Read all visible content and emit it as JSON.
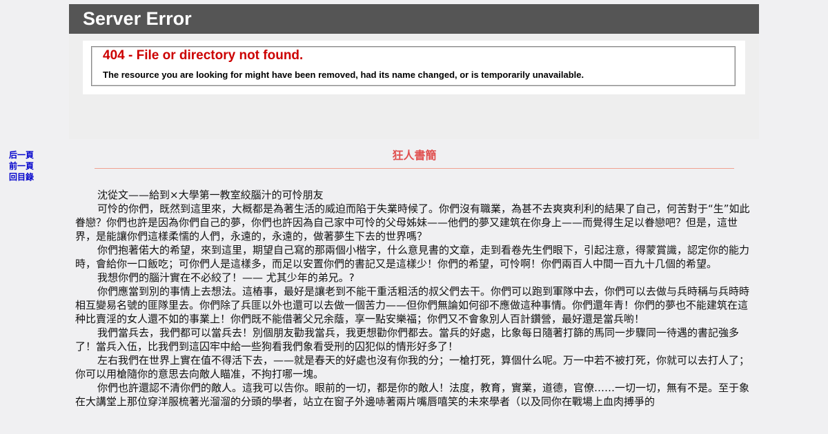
{
  "error": {
    "header": "Server Error",
    "code_line": "404 - File or directory not found.",
    "description": "The resource you are looking for might have been removed, had its name changed, or is temporarily unavailable."
  },
  "nav": {
    "prev": "后一頁",
    "next": "前一頁",
    "toc": "回目錄"
  },
  "book": {
    "title": "狂人書簡"
  },
  "article": {
    "paragraphs": [
      "沈從文——給到×大學第一教室絞腦汁的可怜朋友",
      "可怜的你們，既然到這里來，大概都是為著生活的威迫而陷于失業時候了。你們沒有職業，為甚不去爽爽利利的結果了自己，何苦對于“生”如此眷戀？你們也許是因為你們自己的夢，你們也許因為自己家中可怜的父母姊妹——他們的夢又建筑在你身上——而覺得生足以眷戀吧？但是，這世界，是能讓你們這樣柔懦的人們，永遠的，永遠的，做著夢生下去的世界嗎？",
      "你們抱著偌大的希望，來到這里，期望自己寫的那兩個小楷字，什么意見書的文章，走到看卷先生們眼下，引起注意，得蒙賞識，認定你的能力時，會給你一口飯吃；可你們人是這樣多，而足以安置你們的書記又是這樣少！你們的希望，可怜啊！你們兩百人中間一百九十几個的希望。",
      "我想你們的腦汁實在不必絞了！—— 尤其少年的弟兄。?",
      "你們應當到別的事情上去想法。這樁事，最好是讓老到不能干重活粗活的叔父們去干。你們可以跑到軍隊中去，你們可以去做与兵時稱与兵時時相互變易名號的匪隊里去。你們除了兵匪以外也還可以去做一個苦力——但你們無論如何卻不應做這种事情。你們還年青！你們的夢也不能建筑在這种比賣淫的女人還不如的事業上！你們既不能借著父兄余蔭，享一點安樂福；你們又不會象別人百計鑽營，最好還是當兵喲！",
      "我們當兵去，我們都可以當兵去！別個朋友勸我當兵，我更想勸你們都去。當兵的好處，比象每日隨著打篩的馬同一步驟同一待遇的書記強多了！當兵入伍，比我們到這囚牢中給一些狗看我們象看受刑的囚犯似的情形好多了！",
      "左右我們在世界上實在值不得活下去，——就是春天的好處也沒有你我的分；一槍打死，算個什么呢。万一中若不被打死，你就可以去打人了；你可以用槍隨你的意思去向敵人瞄准，不拘打哪一塊。",
      "你們也許還認不清你們的敵人。這我可以告你。眼前的一切，都是你的敵人！法度，教育，實業，道德，官僚……一切一切，無有不是。至于象在大講堂上那位穿洋服梳著光溜溜的分頭的學者，站立在窗子外邊哧著兩片嘴唇嘻笑的未來學者（以及同你在戰場上血肉搏爭的"
    ]
  }
}
